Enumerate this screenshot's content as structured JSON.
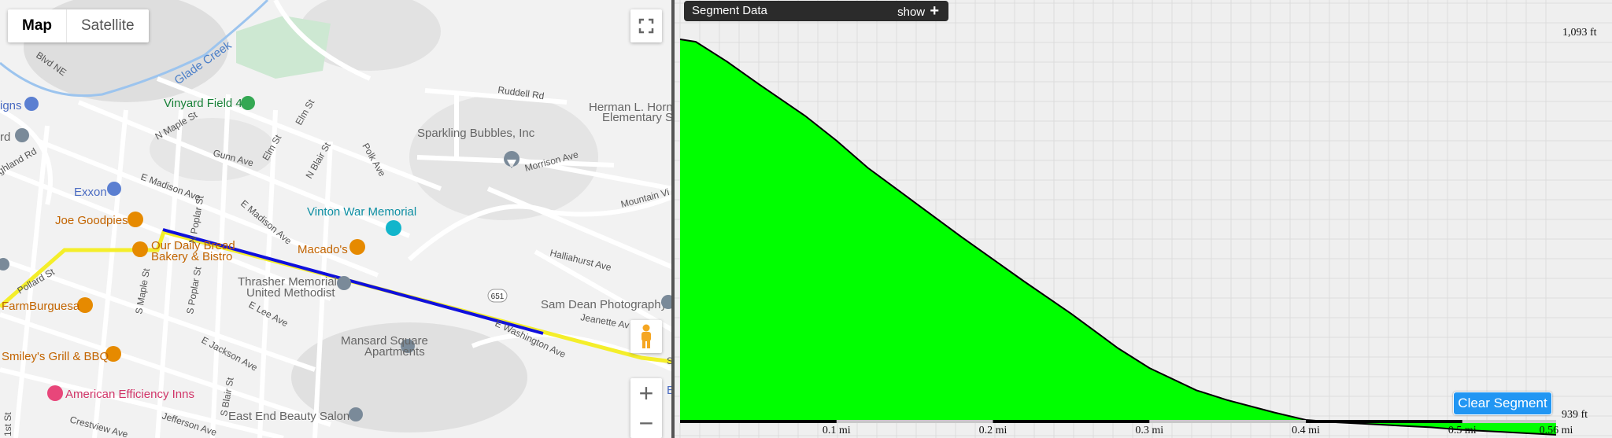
{
  "map": {
    "map_type_buttons": [
      "Map",
      "Satellite"
    ],
    "active_map_type": "Map",
    "controls": {
      "fullscreen": "fullscreen-icon",
      "zoom_in": "+",
      "zoom_out": "−",
      "pegman": "street-view-pegman-icon"
    },
    "streets": {
      "blvd_ne": "Blvd NE",
      "n_maple": "N Maple St",
      "elm1": "Elm St",
      "elm2": "Elm St",
      "gunn": "Gunn Ave",
      "n_blair": "N Blair St",
      "polk": "Polk Ave",
      "highland": "ghland Rd",
      "e_madison1": "E Madison Ave",
      "e_madison2": "E Madison Ave",
      "n_poplar": "N Poplar St",
      "s_maple": "S Maple St",
      "s_poplar": "S Poplar St",
      "e_lee": "E Lee Ave",
      "e_jackson": "E Jackson Ave",
      "s_blair": "S Blair St",
      "jefferson": "Jefferson Ave",
      "crestview": "Crestview Ave",
      "first_st": "1st St",
      "ruddell": "Ruddell Rd",
      "morrison": "Morrison Ave",
      "mountain": "Mountain Vi",
      "halliahurst": "Halliahurst Ave",
      "jeanette": "Jeanette Av",
      "e_washington": "E Washington Ave",
      "pollard": "Pollard St",
      "glade_creek": "Glade Creek",
      "route_651": "651",
      "sun": "Sun"
    },
    "pois": {
      "vinyard": "Vinyard Field 4",
      "herman1": "Herman L. Horn",
      "herman2": "Elementary School",
      "sparkling": "Sparkling Bubbles, Inc",
      "exxon": "Exxon",
      "joe": "Joe Goodpies",
      "ourdaily1": "Our Daily Bread",
      "ourdaily2": "Bakery & Bistro",
      "vinton": "Vinton War Memorial",
      "macados": "Macado's",
      "thrasher1": "Thrasher Memorial",
      "thrasher2": "United Methodist",
      "samdean": "Sam Dean Photography",
      "farmburguesa": "FarmBurguesa",
      "smileys": "Smiley's Grill & BBQ",
      "mansard1": "Mansard Square",
      "mansard2": "Apartments",
      "american": "American Efficiency Inns",
      "eastend": "East End Beauty Salon",
      "signs": "igns",
      "rd": "rd",
      "edge_b": "E"
    }
  },
  "profile": {
    "header": {
      "title": "Segment Data",
      "toggle": "show"
    },
    "clear_button": "Clear Segment"
  },
  "chart_data": {
    "type": "area",
    "title": "",
    "xlabel": "",
    "ylabel": "",
    "x_tick_labels": [
      "0.1 mi",
      "0.2 mi",
      "0.3 mi",
      "0.4 mi",
      "0.5 mi",
      "0.56 mi"
    ],
    "y_labels": [
      "1,093 ft",
      "939 ft"
    ],
    "ylim": [
      939,
      1093
    ],
    "xlim": [
      0,
      0.56
    ],
    "grid": true,
    "fill_color": "#00ff00",
    "line_color": "#000000",
    "series": [
      {
        "x": [
          0,
          0.01,
          0.03,
          0.05,
          0.08,
          0.1,
          0.12,
          0.15,
          0.18,
          0.2,
          0.22,
          0.25,
          0.28,
          0.3,
          0.33,
          0.35,
          0.38,
          0.4,
          0.42,
          0.45,
          0.48,
          0.5,
          0.53,
          0.56
        ],
        "values": [
          1093,
          1092,
          1084,
          1075,
          1062,
          1052,
          1041,
          1027,
          1013,
          1004,
          995,
          982,
          968,
          960,
          951,
          947,
          942,
          939,
          938,
          937,
          936,
          935,
          934,
          933
        ]
      }
    ]
  }
}
